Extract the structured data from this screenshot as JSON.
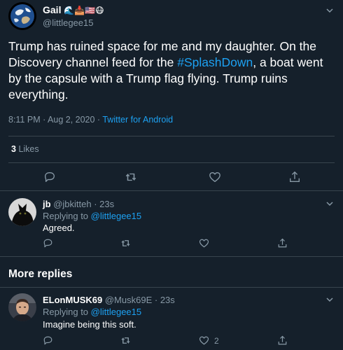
{
  "tweet": {
    "author_name": "Gail",
    "author_emojis": "🌊📥🇺🇸😷",
    "handle": "@littlegee15",
    "text_part1": "Trump has ruined space for me and my daughter. On the Discovery channel feed for the ",
    "hashtag": "#SplashDown",
    "text_part2": ", a boat went by the capsule with a Trump flag flying. Trump ruins everything.",
    "timestamp": "8:11 PM · Aug 2, 2020 · ",
    "source": "Twitter for Android",
    "likes_count": "3",
    "likes_label": "Likes"
  },
  "replies": [
    {
      "name": "jb",
      "handle": "@jbkitteh",
      "time": "· 23s",
      "replying_label": "Replying to ",
      "replying_to": "@littlegee15",
      "text": "Agreed.",
      "like_count": ""
    }
  ],
  "more_replies": {
    "heading": "More replies",
    "items": [
      {
        "name": "ELonMUSK69",
        "handle": "@Musk69E",
        "time": "· 23s",
        "replying_label": "Replying to ",
        "replying_to": "@littlegee15",
        "text": "Imagine being this soft.",
        "like_count": "2"
      }
    ]
  },
  "icons": [
    "chevron-down-icon",
    "reply-icon",
    "retweet-icon",
    "like-icon",
    "share-icon"
  ],
  "colors": {
    "background": "#15202b",
    "divider": "#38444d",
    "muted": "#8899a6",
    "accent": "#1da1f2",
    "text": "#ffffff"
  }
}
